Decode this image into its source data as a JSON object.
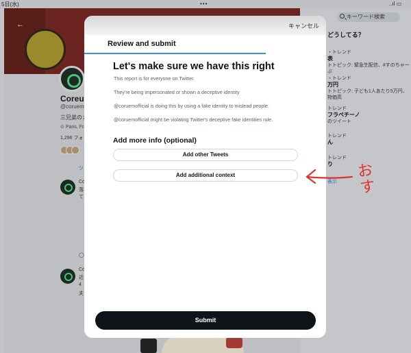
{
  "status_bar": {
    "time": "5日(水)",
    "dots": "•••",
    "signal": "..ıl ▭"
  },
  "background_app": {
    "profile": {
      "name": "Coreum",
      "handle": "@coruemo",
      "bio": "三兄弟のカ",
      "location": "Paris, Fra",
      "following": "1,296 フォ"
    },
    "tab_label": "ツイ",
    "tweets": [
      {
        "name": "Co",
        "line1": "落",
        "line2": "て"
      },
      {
        "name": "Co",
        "line1": "近",
        "line2": "4",
        "line3": "夫"
      }
    ],
    "search_placeholder": "キーワード検索",
    "trends_header": "どうしてる？",
    "trends": [
      {
        "meta": "・トレンド",
        "title": "表",
        "sub": "トトピック: 緊急生配信、#すのちゃーぶ"
      },
      {
        "meta": "・トレンド",
        "title": "万円",
        "sub": "トトピック: 子ども1人あたり5万円、物価高"
      },
      {
        "meta": "トレンド",
        "title": "フラペチーノ",
        "sub": "のツイート"
      },
      {
        "meta": "トレンド",
        "title": "ん",
        "sub": ""
      },
      {
        "meta": "トレンド",
        "title": "り",
        "sub": ""
      }
    ],
    "show_more": "表示"
  },
  "modal": {
    "cancel_label": "キャンセル",
    "step_title": "Review and submit",
    "headline": "Let's make sure we have this right",
    "info_lines": [
      "This report is for everyone on Twitter.",
      "They're being impersonated or shown a deceptive identity",
      "@coruemofficial is doing this by using a fake identity to mislead people.",
      "@coruemofficial might be violating Twitter's deceptive fake identities rule."
    ],
    "add_more_title": "Add more info (optional)",
    "add_tweets_label": "Add other Tweets",
    "add_context_label": "Add additional context",
    "submit_label": "Submit"
  },
  "annotation": {
    "text_line1": "お",
    "text_line2": "す",
    "color": "#e0332c"
  },
  "colors": {
    "accent": "#3b8fd6",
    "submit_bg": "#0f1419",
    "secondary_text": "#536471"
  }
}
